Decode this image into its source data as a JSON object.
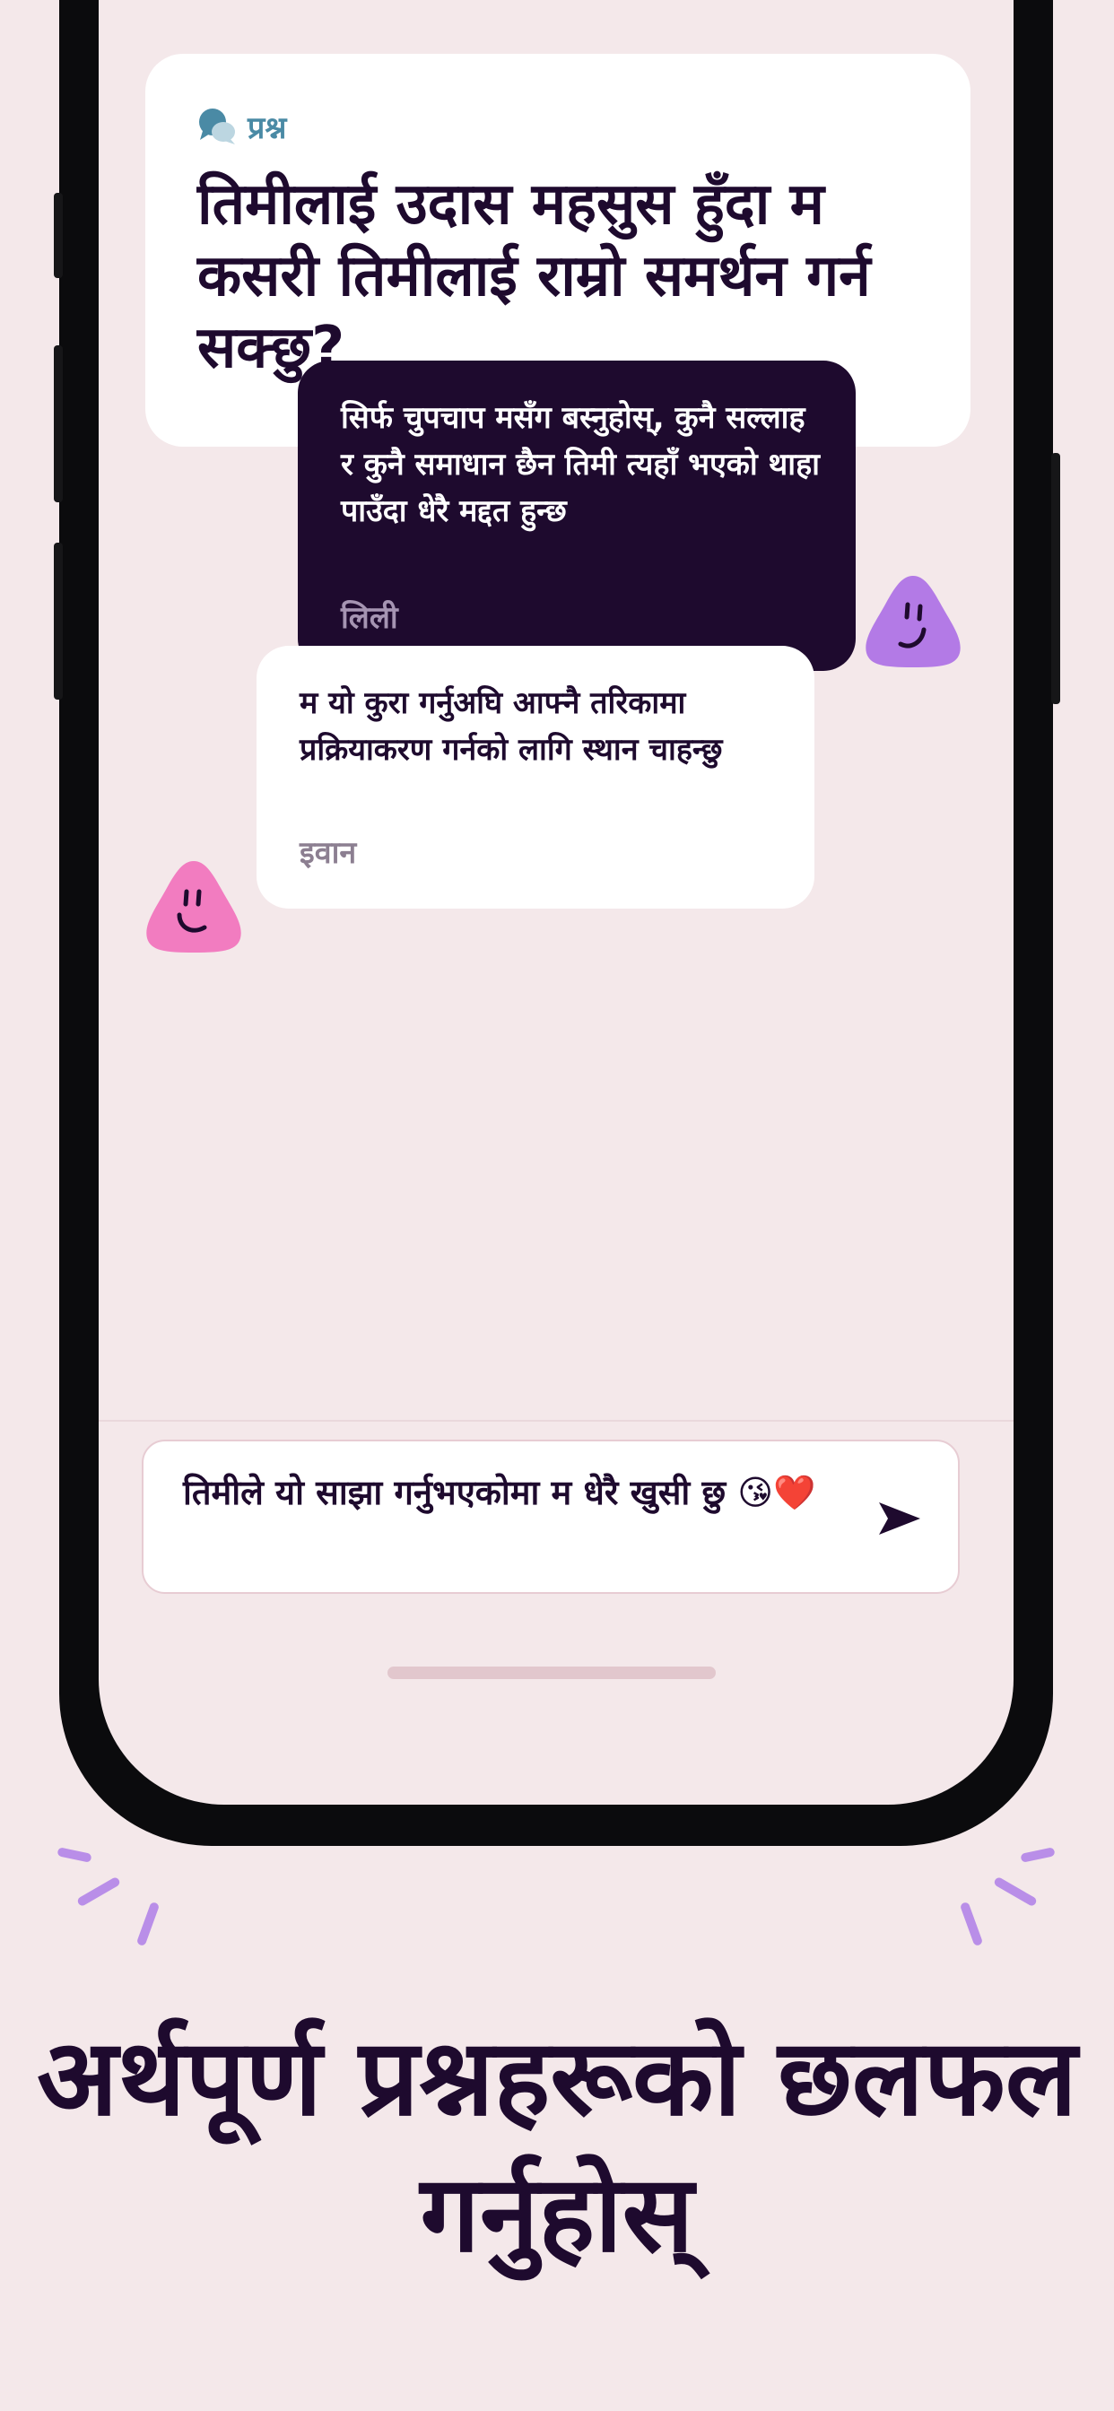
{
  "question_card": {
    "tag_icon": "speech-bubble-icon",
    "tag_label": "प्रश्न",
    "question": "तिमीलाई उदास महसुस हुँदा म कसरी तिमीलाई राम्रो समर्थन गर्न सक्छु?"
  },
  "messages": [
    {
      "text": "सिर्फ चुपचाप मसँग बस्नुहोस्, कुनै सल्लाह र कुनै समाधान छैन  तिमी त्यहाँ भएको थाहा पाउँदा धेरै मद्दत हुन्छ",
      "author": "लिली",
      "avatar_color": "#b37ae6"
    },
    {
      "text": "म यो कुरा गर्नुअघि आफ्नै तरिकामा प्रक्रियाकरण गर्नको लागि स्थान चाहन्छु",
      "author": "इवान",
      "avatar_color": "#f27cc0"
    }
  ],
  "composer": {
    "value": "तिमीले यो साझा गर्नुभएकोमा म धेरै खुसी छु 😘❤️",
    "send_icon": "send-arrow-icon"
  },
  "headline": "अर्थपूर्ण प्रश्नहरूको छलफल गर्नुहोस्",
  "colors": {
    "background": "#f4e8ea",
    "dark_bubble": "#1e0a2e",
    "accent_purple": "#b98ee8",
    "tag_blue": "#4a8aa5"
  }
}
